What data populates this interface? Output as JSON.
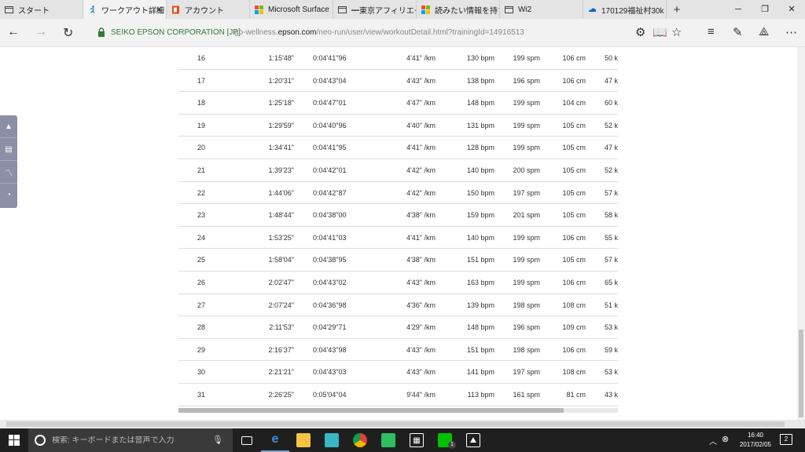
{
  "tabs": [
    {
      "label": "スタート",
      "icon": "page-icon",
      "active": false
    },
    {
      "label": "ワークアウト詳細",
      "icon": "runner-icon",
      "active": true
    },
    {
      "label": "アカウント",
      "icon": "office-icon",
      "active": false
    },
    {
      "label": "Microsoft Surface",
      "icon": "microsoft-icon",
      "active": false
    },
    {
      "label": "━東京アフィリエイト",
      "icon": "page-icon",
      "active": false
    },
    {
      "label": "読みたい情報を持ち",
      "icon": "microsoft-icon",
      "active": false
    },
    {
      "label": "Wi2",
      "icon": "page-icon",
      "active": false
    },
    {
      "label": "170129福祉村30k",
      "icon": "onedrive-icon",
      "active": false
    }
  ],
  "address_bar": {
    "site_identity": "SEIKO EPSON CORPORATION [JP]",
    "url_prefix": "go-wellness.",
    "url_domain": "epson.com",
    "url_path": "/neo-run/user/view/workoutDetail.html?trainingId=14916513"
  },
  "laps": [
    {
      "lap": "16",
      "total": "1:15'48\"",
      "split": "0:04'41\"96",
      "pace": "4'41\" /km",
      "hr": "130 bpm",
      "cadence": "199 spm",
      "stride": "106 cm",
      "last": "50 k"
    },
    {
      "lap": "17",
      "total": "1:20'31\"",
      "split": "0:04'43\"04",
      "pace": "4'43\" /km",
      "hr": "138 bpm",
      "cadence": "196 spm",
      "stride": "106 cm",
      "last": "47 k"
    },
    {
      "lap": "18",
      "total": "1:25'18\"",
      "split": "0:04'47\"01",
      "pace": "4'47\" /km",
      "hr": "148 bpm",
      "cadence": "199 spm",
      "stride": "104 cm",
      "last": "60 k"
    },
    {
      "lap": "19",
      "total": "1:29'59\"",
      "split": "0:04'40\"96",
      "pace": "4'40\" /km",
      "hr": "131 bpm",
      "cadence": "199 spm",
      "stride": "105 cm",
      "last": "52 k"
    },
    {
      "lap": "20",
      "total": "1:34'41\"",
      "split": "0:04'41\"95",
      "pace": "4'41\" /km",
      "hr": "128 bpm",
      "cadence": "199 spm",
      "stride": "105 cm",
      "last": "47 k"
    },
    {
      "lap": "21",
      "total": "1:39'23\"",
      "split": "0:04'42\"01",
      "pace": "4'42\" /km",
      "hr": "140 bpm",
      "cadence": "200 spm",
      "stride": "105 cm",
      "last": "52 k"
    },
    {
      "lap": "22",
      "total": "1:44'06\"",
      "split": "0:04'42\"87",
      "pace": "4'42\" /km",
      "hr": "150 bpm",
      "cadence": "197 spm",
      "stride": "105 cm",
      "last": "57 k"
    },
    {
      "lap": "23",
      "total": "1:48'44\"",
      "split": "0:04'38\"00",
      "pace": "4'38\" /km",
      "hr": "159 bpm",
      "cadence": "201 spm",
      "stride": "105 cm",
      "last": "58 k"
    },
    {
      "lap": "24",
      "total": "1:53'25\"",
      "split": "0:04'41\"03",
      "pace": "4'41\" /km",
      "hr": "140 bpm",
      "cadence": "199 spm",
      "stride": "106 cm",
      "last": "55 k"
    },
    {
      "lap": "25",
      "total": "1:58'04\"",
      "split": "0:04'38\"95",
      "pace": "4'38\" /km",
      "hr": "151 bpm",
      "cadence": "199 spm",
      "stride": "105 cm",
      "last": "57 k"
    },
    {
      "lap": "26",
      "total": "2:02'47\"",
      "split": "0:04'43\"02",
      "pace": "4'43\" /km",
      "hr": "163 bpm",
      "cadence": "199 spm",
      "stride": "106 cm",
      "last": "65 k"
    },
    {
      "lap": "27",
      "total": "2:07'24\"",
      "split": "0:04'36\"98",
      "pace": "4'36\" /km",
      "hr": "139 bpm",
      "cadence": "198 spm",
      "stride": "108 cm",
      "last": "51 k"
    },
    {
      "lap": "28",
      "total": "2:11'53\"",
      "split": "0:04'29\"71",
      "pace": "4'29\" /km",
      "hr": "148 bpm",
      "cadence": "196 spm",
      "stride": "109 cm",
      "last": "53 k"
    },
    {
      "lap": "29",
      "total": "2:16'37\"",
      "split": "0:04'43\"98",
      "pace": "4'43\" /km",
      "hr": "151 bpm",
      "cadence": "198 spm",
      "stride": "106 cm",
      "last": "59 k"
    },
    {
      "lap": "30",
      "total": "2:21'21\"",
      "split": "0:04'43\"03",
      "pace": "4'43\" /km",
      "hr": "141 bpm",
      "cadence": "197 spm",
      "stride": "108 cm",
      "last": "53 k"
    },
    {
      "lap": "31",
      "total": "2:26'25\"",
      "split": "0:05'04\"04",
      "pace": "9'44\" /km",
      "hr": "113 bpm",
      "cadence": "161 spm",
      "stride": "81 cm",
      "last": "43 k"
    }
  ],
  "sidebar_tools": [
    "top-icon",
    "document-icon",
    "chart-icon",
    "clock-icon"
  ],
  "taskbar": {
    "search_placeholder": "検索: キーボードまたは音声で入力",
    "time": "16:40",
    "date": "2017/02/05",
    "notification_count": "2",
    "line_badge": "1"
  },
  "colors": {
    "site_identity": "#2e7d32",
    "sidebar": "#8d8fa6",
    "taskbar": "#1f1f1f"
  }
}
